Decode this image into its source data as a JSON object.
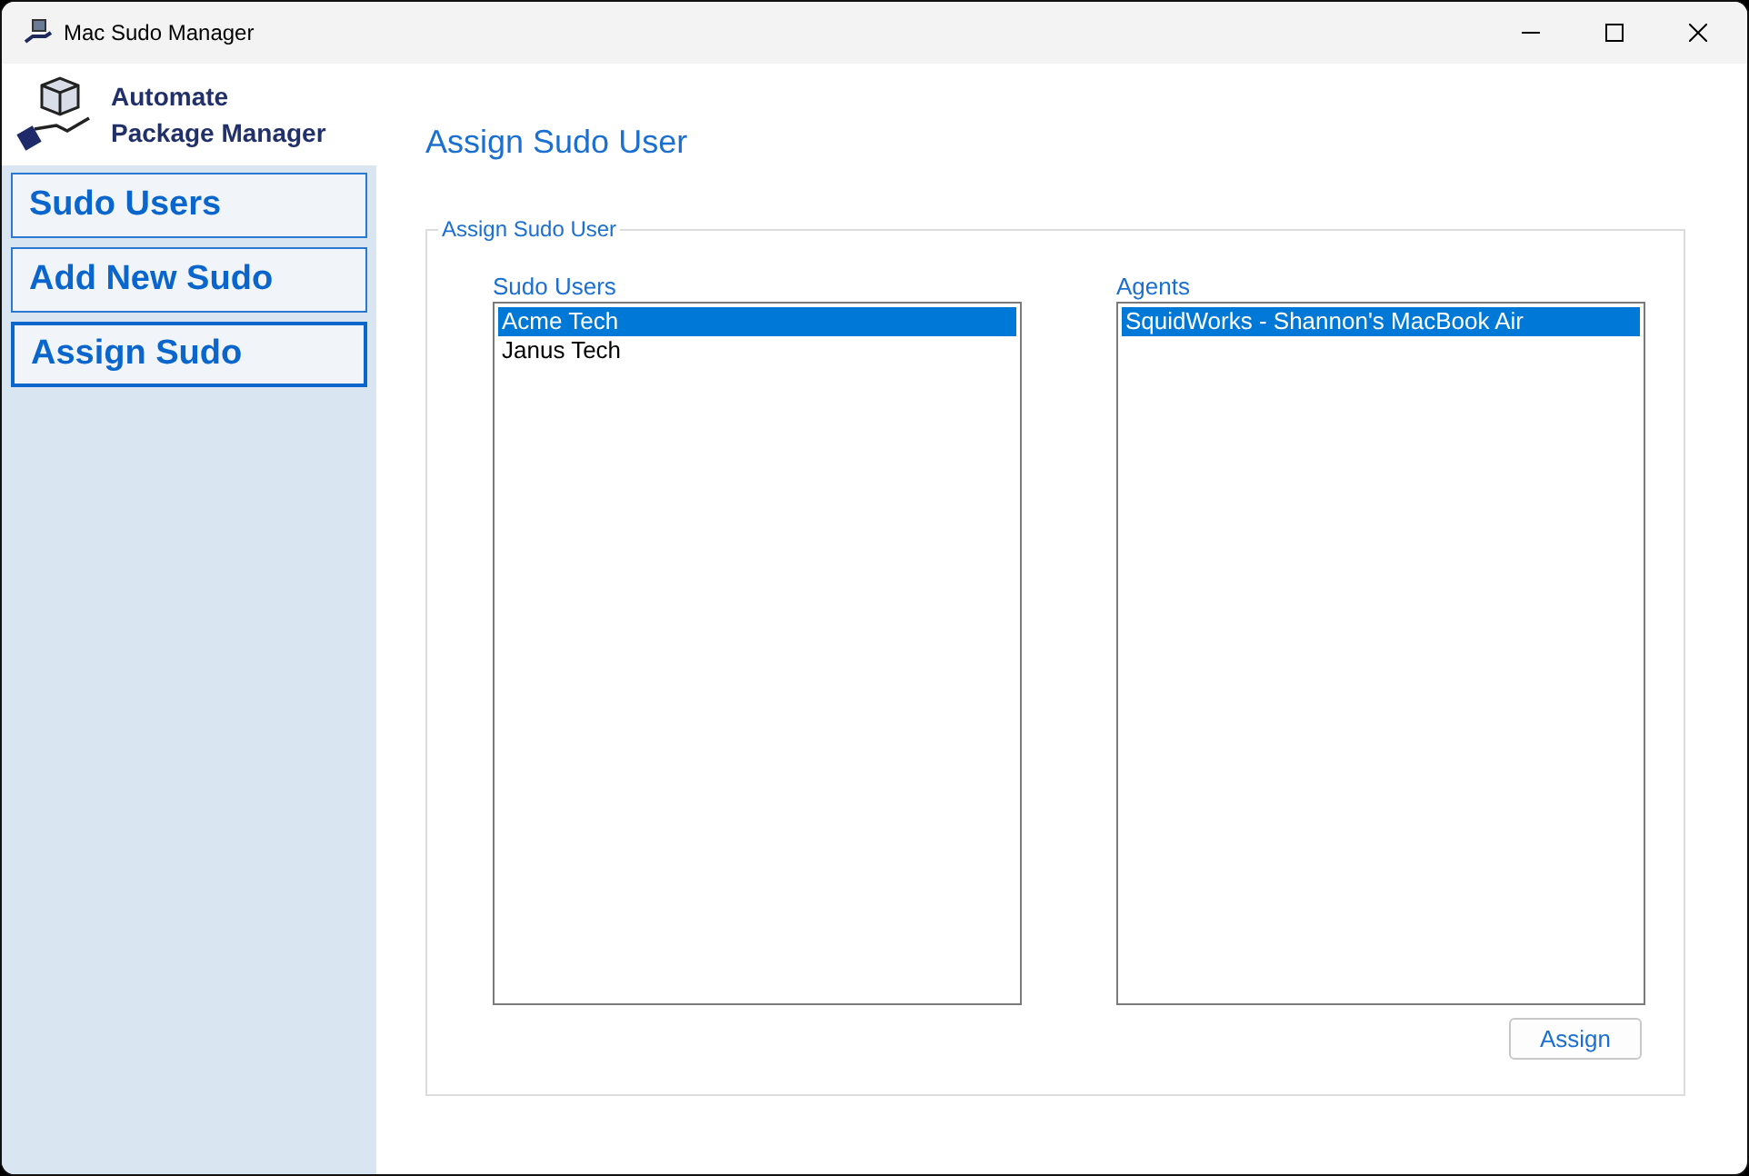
{
  "window": {
    "title": "Mac Sudo Manager"
  },
  "brand": {
    "lines": [
      "Automate",
      "Package Manager"
    ]
  },
  "nav": [
    {
      "label": "Sudo Users",
      "selected": false
    },
    {
      "label": "Add New Sudo",
      "selected": false
    },
    {
      "label": "Assign Sudo",
      "selected": true
    }
  ],
  "heading": "Assign Sudo User",
  "group": {
    "title": "Assign Sudo User",
    "lists": [
      {
        "label": "Sudo Users",
        "items": [
          {
            "text": "Acme Tech",
            "selected": true
          },
          {
            "text": "Janus Tech",
            "selected": false
          }
        ]
      },
      {
        "label": "Agents",
        "items": [
          {
            "text": "SquidWorks - Shannon's MacBook Air",
            "selected": true
          }
        ]
      }
    ],
    "button": "Assign"
  }
}
